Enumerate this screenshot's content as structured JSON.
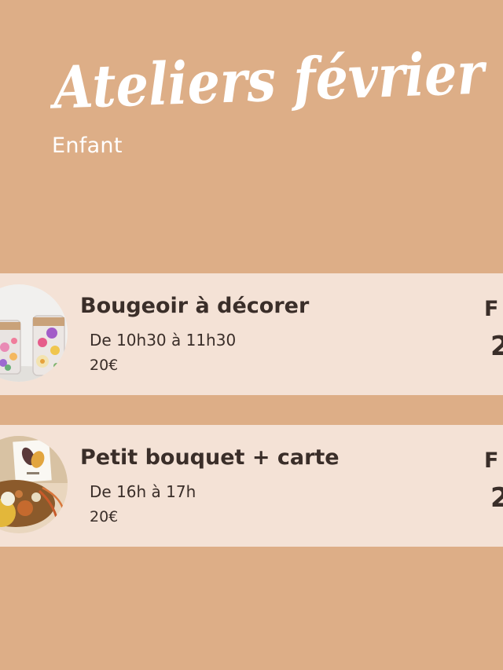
{
  "header": {
    "title": "Ateliers février",
    "subtitle": "Enfant"
  },
  "workshops": [
    {
      "title": "Bougeoir à décorer",
      "time": "De 10h30 à 11h30",
      "price": "20€",
      "side_label": "F",
      "side_value": "2",
      "image": "decorated-candle-jars-photo"
    },
    {
      "title": "Petit bouquet + carte",
      "time": "De 16h à 17h",
      "price": "20€",
      "side_label": "F",
      "side_value": "2",
      "image": "dried-flower-bouquet-card-photo"
    }
  ],
  "colors": {
    "background": "#DDAE87",
    "card": "#F4E2D6",
    "text": "#3A2E29",
    "title": "#FFFFFF"
  }
}
